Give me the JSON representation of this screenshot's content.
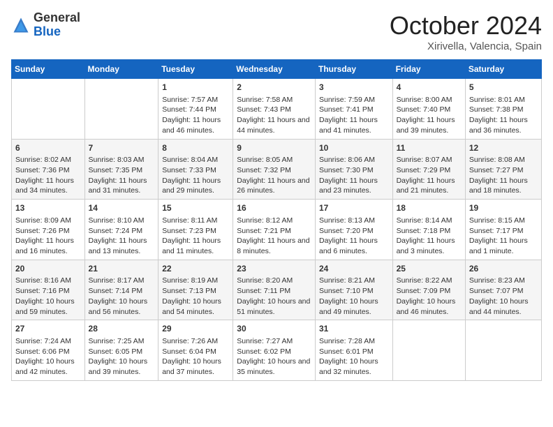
{
  "header": {
    "logo_general": "General",
    "logo_blue": "Blue",
    "month": "October 2024",
    "location": "Xirivella, Valencia, Spain"
  },
  "days_of_week": [
    "Sunday",
    "Monday",
    "Tuesday",
    "Wednesday",
    "Thursday",
    "Friday",
    "Saturday"
  ],
  "weeks": [
    [
      {
        "num": "",
        "content": ""
      },
      {
        "num": "",
        "content": ""
      },
      {
        "num": "1",
        "content": "Sunrise: 7:57 AM\nSunset: 7:44 PM\nDaylight: 11 hours and 46 minutes."
      },
      {
        "num": "2",
        "content": "Sunrise: 7:58 AM\nSunset: 7:43 PM\nDaylight: 11 hours and 44 minutes."
      },
      {
        "num": "3",
        "content": "Sunrise: 7:59 AM\nSunset: 7:41 PM\nDaylight: 11 hours and 41 minutes."
      },
      {
        "num": "4",
        "content": "Sunrise: 8:00 AM\nSunset: 7:40 PM\nDaylight: 11 hours and 39 minutes."
      },
      {
        "num": "5",
        "content": "Sunrise: 8:01 AM\nSunset: 7:38 PM\nDaylight: 11 hours and 36 minutes."
      }
    ],
    [
      {
        "num": "6",
        "content": "Sunrise: 8:02 AM\nSunset: 7:36 PM\nDaylight: 11 hours and 34 minutes."
      },
      {
        "num": "7",
        "content": "Sunrise: 8:03 AM\nSunset: 7:35 PM\nDaylight: 11 hours and 31 minutes."
      },
      {
        "num": "8",
        "content": "Sunrise: 8:04 AM\nSunset: 7:33 PM\nDaylight: 11 hours and 29 minutes."
      },
      {
        "num": "9",
        "content": "Sunrise: 8:05 AM\nSunset: 7:32 PM\nDaylight: 11 hours and 26 minutes."
      },
      {
        "num": "10",
        "content": "Sunrise: 8:06 AM\nSunset: 7:30 PM\nDaylight: 11 hours and 23 minutes."
      },
      {
        "num": "11",
        "content": "Sunrise: 8:07 AM\nSunset: 7:29 PM\nDaylight: 11 hours and 21 minutes."
      },
      {
        "num": "12",
        "content": "Sunrise: 8:08 AM\nSunset: 7:27 PM\nDaylight: 11 hours and 18 minutes."
      }
    ],
    [
      {
        "num": "13",
        "content": "Sunrise: 8:09 AM\nSunset: 7:26 PM\nDaylight: 11 hours and 16 minutes."
      },
      {
        "num": "14",
        "content": "Sunrise: 8:10 AM\nSunset: 7:24 PM\nDaylight: 11 hours and 13 minutes."
      },
      {
        "num": "15",
        "content": "Sunrise: 8:11 AM\nSunset: 7:23 PM\nDaylight: 11 hours and 11 minutes."
      },
      {
        "num": "16",
        "content": "Sunrise: 8:12 AM\nSunset: 7:21 PM\nDaylight: 11 hours and 8 minutes."
      },
      {
        "num": "17",
        "content": "Sunrise: 8:13 AM\nSunset: 7:20 PM\nDaylight: 11 hours and 6 minutes."
      },
      {
        "num": "18",
        "content": "Sunrise: 8:14 AM\nSunset: 7:18 PM\nDaylight: 11 hours and 3 minutes."
      },
      {
        "num": "19",
        "content": "Sunrise: 8:15 AM\nSunset: 7:17 PM\nDaylight: 11 hours and 1 minute."
      }
    ],
    [
      {
        "num": "20",
        "content": "Sunrise: 8:16 AM\nSunset: 7:16 PM\nDaylight: 10 hours and 59 minutes."
      },
      {
        "num": "21",
        "content": "Sunrise: 8:17 AM\nSunset: 7:14 PM\nDaylight: 10 hours and 56 minutes."
      },
      {
        "num": "22",
        "content": "Sunrise: 8:19 AM\nSunset: 7:13 PM\nDaylight: 10 hours and 54 minutes."
      },
      {
        "num": "23",
        "content": "Sunrise: 8:20 AM\nSunset: 7:11 PM\nDaylight: 10 hours and 51 minutes."
      },
      {
        "num": "24",
        "content": "Sunrise: 8:21 AM\nSunset: 7:10 PM\nDaylight: 10 hours and 49 minutes."
      },
      {
        "num": "25",
        "content": "Sunrise: 8:22 AM\nSunset: 7:09 PM\nDaylight: 10 hours and 46 minutes."
      },
      {
        "num": "26",
        "content": "Sunrise: 8:23 AM\nSunset: 7:07 PM\nDaylight: 10 hours and 44 minutes."
      }
    ],
    [
      {
        "num": "27",
        "content": "Sunrise: 7:24 AM\nSunset: 6:06 PM\nDaylight: 10 hours and 42 minutes."
      },
      {
        "num": "28",
        "content": "Sunrise: 7:25 AM\nSunset: 6:05 PM\nDaylight: 10 hours and 39 minutes."
      },
      {
        "num": "29",
        "content": "Sunrise: 7:26 AM\nSunset: 6:04 PM\nDaylight: 10 hours and 37 minutes."
      },
      {
        "num": "30",
        "content": "Sunrise: 7:27 AM\nSunset: 6:02 PM\nDaylight: 10 hours and 35 minutes."
      },
      {
        "num": "31",
        "content": "Sunrise: 7:28 AM\nSunset: 6:01 PM\nDaylight: 10 hours and 32 minutes."
      },
      {
        "num": "",
        "content": ""
      },
      {
        "num": "",
        "content": ""
      }
    ]
  ]
}
